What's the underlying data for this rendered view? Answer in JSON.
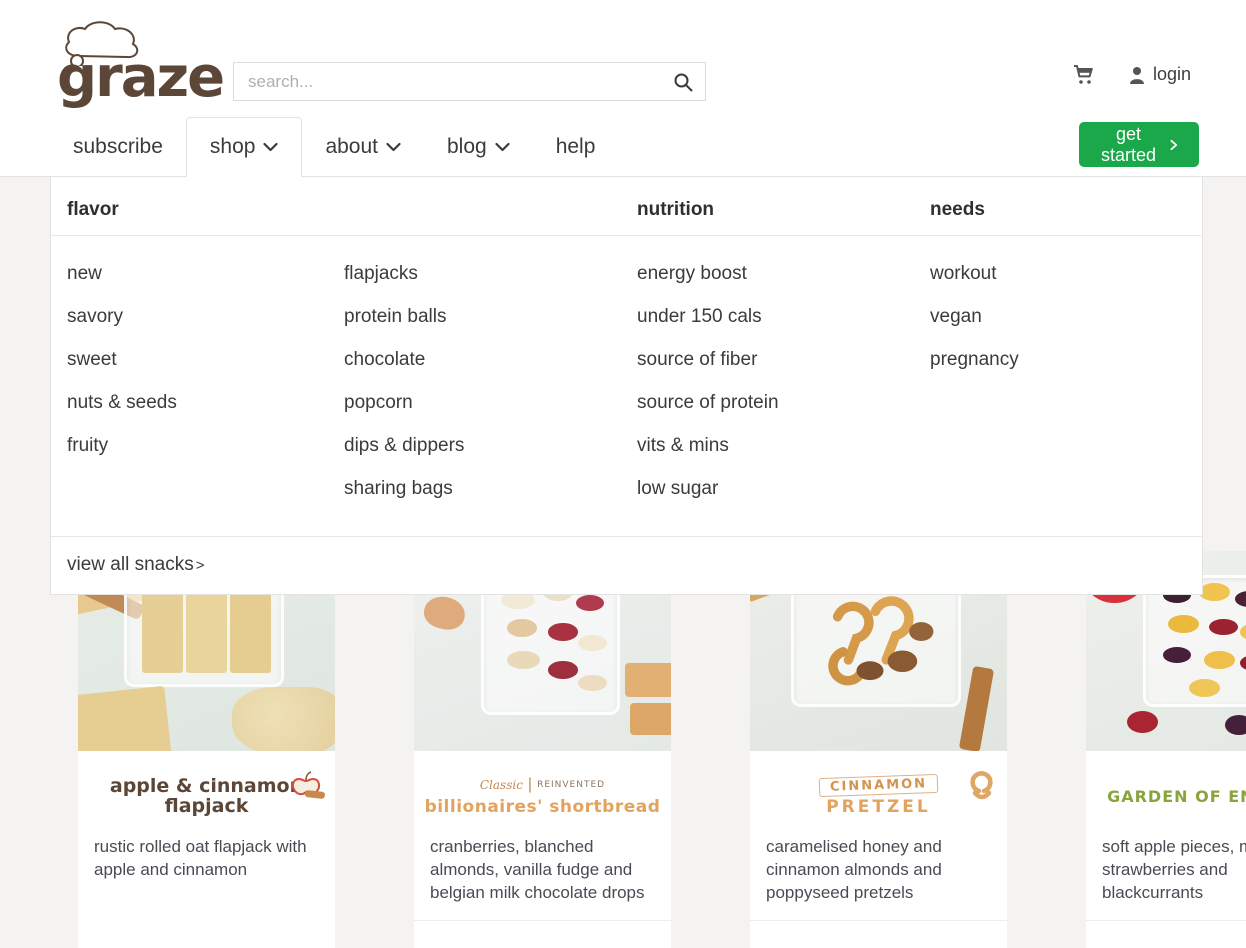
{
  "brand": {
    "name": "graze",
    "logo_icon": "cloud-logo-icon"
  },
  "search": {
    "placeholder": "search...",
    "value": "",
    "icon": "search-icon"
  },
  "account": {
    "cart_icon": "shopping-cart-icon",
    "user_icon": "user-icon",
    "login_label": "login",
    "cta_label": "get started",
    "cta_icon": "chevron-right-icon",
    "cta_color": "#1aa84a"
  },
  "nav": {
    "items": [
      {
        "label": "subscribe",
        "has_caret": false,
        "active": false
      },
      {
        "label": "shop",
        "has_caret": true,
        "active": true
      },
      {
        "label": "about",
        "has_caret": true,
        "active": false
      },
      {
        "label": "blog",
        "has_caret": true,
        "active": false
      },
      {
        "label": "help",
        "has_caret": false,
        "active": false
      }
    ]
  },
  "mega_menu": {
    "headers": {
      "flavor": "flavor",
      "nutrition": "nutrition",
      "needs": "needs"
    },
    "flavor_col1": [
      "new",
      "savory",
      "sweet",
      "nuts & seeds",
      "fruity"
    ],
    "flavor_col2": [
      "flapjacks",
      "protein balls",
      "chocolate",
      "popcorn",
      "dips & dippers",
      "sharing bags"
    ],
    "nutrition": [
      "energy boost",
      "under 150 cals",
      "source of fiber",
      "source of protein",
      "vits & mins",
      "low sugar"
    ],
    "needs": [
      "workout",
      "vegan",
      "pregnancy"
    ],
    "footer_link": "view all snacks",
    "footer_arrow": ">"
  },
  "products": [
    {
      "logo_line1": "apple & cinnamon",
      "logo_line2": "flapjack",
      "logo_icon": "apple-cinnamon-icon",
      "description": "rustic rolled oat flapjack with apple and cinnamon",
      "image_alt": "oat flapjack bars in tray with oats"
    },
    {
      "logo_kicker_left": "Classic",
      "logo_kicker_right": "REINVENTED",
      "logo_line2": "billionaires' shortbread",
      "logo_icon": "shortbread-wordmark-icon",
      "description": "cranberries, blanched almonds, vanilla fudge and belgian milk chocolate drops",
      "image_alt": "almonds, cranberries and fudge in tray"
    },
    {
      "logo_line1": "CINNAMON",
      "logo_line2": "PRETZEL",
      "logo_icon": "pretzel-icon",
      "description": "caramelised honey and cinnamon almonds and poppyseed pretzels",
      "image_alt": "pretzels and cinnamon almonds in tray"
    },
    {
      "logo_line1": "GARDEN OF ENGLAND",
      "logo_line2": "",
      "logo_icon": "fruit-baskets-icon",
      "description": "soft apple pieces, mini strawberries and blackcurrants",
      "image_alt": "apple pieces, strawberries and blackcurrants in tray"
    }
  ]
}
